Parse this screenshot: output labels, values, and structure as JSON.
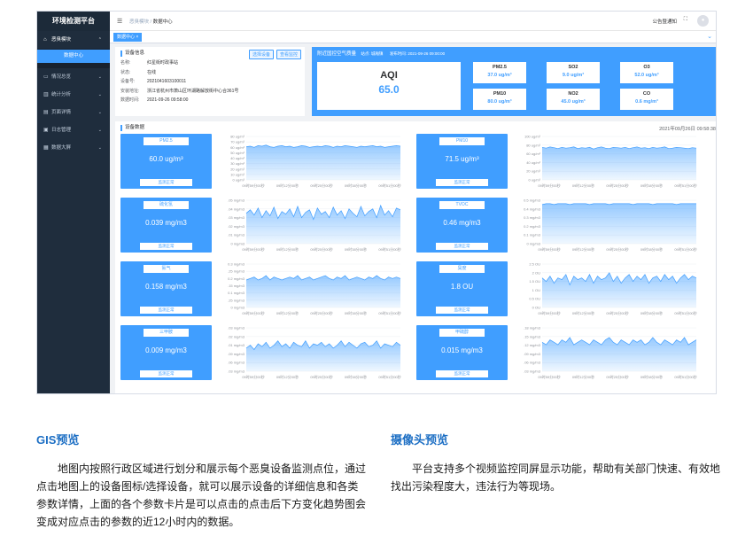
{
  "app": {
    "title": "环境检测平台",
    "menu": [
      {
        "icon": "⌂",
        "label": "恶臭模块",
        "arrow": "⌃",
        "open": true
      },
      {
        "icon": "▭",
        "label": "情况总览",
        "arrow": "⌄"
      },
      {
        "icon": "▥",
        "label": "统计分析",
        "arrow": "⌄"
      },
      {
        "icon": "▤",
        "label": "页面详情",
        "arrow": "⌄"
      },
      {
        "icon": "▣",
        "label": "日志管理",
        "arrow": "⌄"
      },
      {
        "icon": "▦",
        "label": "数据大屏",
        "arrow": "⌄"
      }
    ],
    "submenu_active": "数据中心",
    "breadcrumb": {
      "parent": "恶臭模块",
      "sep": "/",
      "current": "数据中心"
    },
    "notice": "公告暨通知",
    "tab": "数据中心 ×"
  },
  "device_info": {
    "title": "设备信息",
    "buttons": [
      "选择设备",
      "查看监控"
    ],
    "rows": [
      {
        "k": "名称:",
        "v": "红星街时政事站"
      },
      {
        "k": "状态:",
        "v": "在线"
      },
      {
        "k": "设备号:",
        "v": "2021041603100011"
      },
      {
        "k": "安装地址:",
        "v": "浙江省杭州市萧山区环湖路解放街中心合361号"
      },
      {
        "k": "数据时间:",
        "v": "2021-09-26 09:58:00"
      }
    ]
  },
  "air": {
    "title": "附近国控空气质量",
    "site": "站点: 城厢镇",
    "time": "发布时间: 2021-09-26 09:00:00",
    "aqi_label": "AQI",
    "aqi_value": "65.0",
    "pollutants": [
      {
        "name": "PM2.5",
        "value": "37.0 ug/m³"
      },
      {
        "name": "SO2",
        "value": "9.0 ug/m³"
      },
      {
        "name": "O3",
        "value": "52.0 ug/m³"
      },
      {
        "name": "PM10",
        "value": "80.0 ug/m³"
      },
      {
        "name": "NO2",
        "value": "45.0 ug/m³"
      },
      {
        "name": "CO",
        "value": "0.6 mg/m³"
      }
    ]
  },
  "device_data": {
    "title": "设备数据",
    "time": "2021年09月26日 09:58:38",
    "status_label": "监测正常",
    "x_ticks": [
      "09时59分00秒",
      "09时12分00秒",
      "09时25分00秒",
      "09时38分00秒",
      "09时51分00秒"
    ],
    "accent": "#409eff"
  },
  "chart_data": [
    {
      "type": "area",
      "name": "PM2.5",
      "current": "60.0 ug/m³",
      "y_ticks": [
        "80 ug/m³",
        "70 ug/m³",
        "60 ug/m³",
        "50 ug/m³",
        "40 ug/m³",
        "30 ug/m³",
        "20 ug/m³",
        "10 ug/m³",
        "0 ug/m³"
      ],
      "ylim": [
        0,
        80
      ],
      "values": [
        61,
        62,
        60,
        63,
        62,
        64,
        61,
        60,
        62,
        63,
        61,
        62,
        60,
        61,
        63,
        62,
        60,
        61,
        62,
        61,
        63,
        62,
        60,
        62,
        61,
        63,
        62,
        61,
        60,
        62,
        61,
        62,
        63,
        61,
        62,
        60,
        61,
        62,
        63,
        62
      ]
    },
    {
      "type": "area",
      "name": "PM10",
      "current": "71.5 ug/m³",
      "y_ticks": [
        "100 ug/m³",
        "80 ug/m³",
        "60 ug/m³",
        "40 ug/m³",
        "20 ug/m³",
        "0 ug/m³"
      ],
      "ylim": [
        0,
        100
      ],
      "values": [
        75,
        73,
        76,
        74,
        72,
        75,
        73,
        74,
        76,
        72,
        74,
        73,
        75,
        71,
        74,
        76,
        73,
        72,
        75,
        74,
        73,
        75,
        72,
        74,
        76,
        73,
        74,
        72,
        75,
        73,
        74,
        76,
        72,
        73,
        75,
        74,
        73,
        72,
        74,
        73
      ]
    },
    {
      "type": "area",
      "name": "硫化氢",
      "current": "0.039 mg/m3",
      "y_ticks": [
        ".05 mg/m3",
        ".04 mg/m3",
        ".03 mg/m3",
        ".02 mg/m3",
        ".01 mg/m3",
        "0 mg/m3"
      ],
      "ylim": [
        0,
        0.05
      ],
      "values": [
        0.035,
        0.039,
        0.033,
        0.041,
        0.03,
        0.038,
        0.032,
        0.042,
        0.029,
        0.037,
        0.034,
        0.04,
        0.031,
        0.043,
        0.03,
        0.036,
        0.039,
        0.028,
        0.041,
        0.034,
        0.037,
        0.03,
        0.042,
        0.033,
        0.038,
        0.029,
        0.04,
        0.035,
        0.031,
        0.043,
        0.032,
        0.037,
        0.04,
        0.03,
        0.044,
        0.033,
        0.038,
        0.031,
        0.041,
        0.039
      ]
    },
    {
      "type": "area",
      "name": "TVOC",
      "current": "0.46 mg/m3",
      "y_ticks": [
        "0.5 mg/m3",
        "0.4 mg/m3",
        "0.3 mg/m3",
        "0.2 mg/m3",
        "0.1 mg/m3",
        "0 mg/m3"
      ],
      "ylim": [
        0,
        0.5
      ],
      "values": [
        0.45,
        0.46,
        0.46,
        0.45,
        0.46,
        0.46,
        0.46,
        0.45,
        0.46,
        0.46,
        0.46,
        0.46,
        0.45,
        0.46,
        0.46,
        0.46,
        0.46,
        0.45,
        0.46,
        0.46,
        0.46,
        0.46,
        0.46,
        0.45,
        0.46,
        0.46,
        0.46,
        0.46,
        0.45,
        0.46,
        0.46,
        0.46,
        0.46,
        0.46,
        0.45,
        0.46,
        0.46,
        0.46,
        0.46,
        0.46
      ]
    },
    {
      "type": "area",
      "name": "氨气",
      "current": "0.158 mg/m3",
      "y_ticks": [
        "0.3 mg/m3",
        ".25 mg/m3",
        "0.2 mg/m3",
        ".15 mg/m3",
        "0.1 mg/m3",
        ".25 mg/m3",
        "0 mg/m3"
      ],
      "ylim": [
        0,
        0.3
      ],
      "values": [
        0.19,
        0.2,
        0.21,
        0.19,
        0.2,
        0.22,
        0.19,
        0.21,
        0.2,
        0.19,
        0.2,
        0.21,
        0.2,
        0.22,
        0.19,
        0.2,
        0.21,
        0.19,
        0.2,
        0.21,
        0.22,
        0.2,
        0.19,
        0.21,
        0.2,
        0.22,
        0.19,
        0.2,
        0.21,
        0.2,
        0.19,
        0.21,
        0.2,
        0.22,
        0.2,
        0.19,
        0.21,
        0.2,
        0.21,
        0.2
      ]
    },
    {
      "type": "area",
      "name": "臭度",
      "current": "1.8 OU",
      "y_ticks": [
        "2.5 OU",
        "2 OU",
        "1.5 OU",
        "1 OU",
        "0.5 OU",
        "0 OU"
      ],
      "ylim": [
        0,
        2.5
      ],
      "values": [
        1.7,
        1.5,
        1.8,
        1.4,
        1.7,
        1.6,
        1.9,
        1.3,
        1.8,
        1.6,
        1.7,
        1.5,
        1.9,
        1.4,
        1.8,
        1.6,
        1.7,
        2.0,
        1.5,
        1.8,
        1.4,
        1.7,
        1.9,
        1.5,
        1.8,
        1.6,
        1.9,
        1.4,
        1.7,
        1.8,
        1.5,
        1.9,
        1.6,
        1.8,
        1.4,
        1.7,
        1.9,
        1.6,
        1.8,
        1.7
      ]
    },
    {
      "type": "area",
      "name": "三甲胺",
      "current": "0.009 mg/m3",
      "y_ticks": [
        ".03 mg/m3",
        ".02 mg/m3",
        ".01 mg/m3",
        ".09 mg/m3",
        ".06 mg/m3",
        ".03 mg/m3"
      ],
      "ylim": [
        0,
        0.03
      ],
      "values": [
        0.016,
        0.018,
        0.015,
        0.019,
        0.017,
        0.02,
        0.016,
        0.018,
        0.021,
        0.017,
        0.019,
        0.016,
        0.02,
        0.018,
        0.017,
        0.021,
        0.016,
        0.019,
        0.018,
        0.02,
        0.017,
        0.019,
        0.016,
        0.018,
        0.021,
        0.017,
        0.02,
        0.018,
        0.016,
        0.019,
        0.02,
        0.017,
        0.018,
        0.021,
        0.016,
        0.019,
        0.018,
        0.017,
        0.02,
        0.018
      ]
    },
    {
      "type": "area",
      "name": "甲硫醇",
      "current": "0.015 mg/m3",
      "y_ticks": [
        ".18 mg/m3",
        ".15 mg/m3",
        ".12 mg/m3",
        ".09 mg/m3",
        ".06 mg/m3",
        ".03 mg/m3"
      ],
      "ylim": [
        0,
        0.18
      ],
      "values": [
        0.12,
        0.11,
        0.13,
        0.12,
        0.11,
        0.13,
        0.12,
        0.14,
        0.11,
        0.12,
        0.13,
        0.12,
        0.11,
        0.13,
        0.12,
        0.11,
        0.13,
        0.14,
        0.12,
        0.11,
        0.13,
        0.12,
        0.11,
        0.13,
        0.12,
        0.13,
        0.11,
        0.12,
        0.14,
        0.12,
        0.11,
        0.13,
        0.12,
        0.11,
        0.13,
        0.12,
        0.14,
        0.11,
        0.12,
        0.13
      ]
    }
  ],
  "sections": {
    "gis": {
      "title": "GIS预览",
      "text": "地图内按照行政区域进行划分和展示每个恶臭设备监测点位，通过点击地图上的设备图标/选择设备，就可以展示设备的详细信息和各类参数详情，上面的各个参数卡片是可以点击的点击后下方变化趋势图会变成对应点击的参数的近12小时内的数据。"
    },
    "camera": {
      "title": "摄像头预览",
      "text": "平台支持多个视频监控同屏显示功能，帮助有关部门快速、有效地找出污染程度大，违法行为等现场。"
    }
  }
}
